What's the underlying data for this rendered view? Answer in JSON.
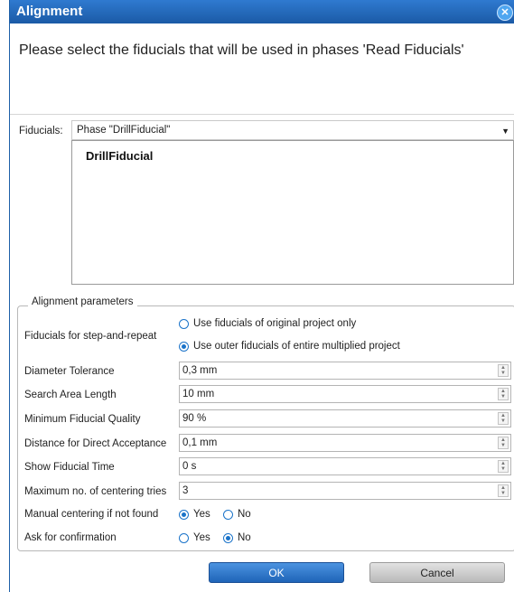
{
  "window": {
    "title": "Alignment",
    "close_symbol": "✕"
  },
  "instruction": "Please select the fiducials that will be used in phases 'Read Fiducials'",
  "fiducials": {
    "label": "Fiducials:",
    "selected_phase": "Phase \"DrillFiducial\"",
    "items": [
      "DrillFiducial"
    ]
  },
  "params": {
    "legend": "Alignment parameters",
    "step_repeat": {
      "label": "Fiducials for step-and-repeat",
      "options": [
        "Use fiducials of original project only",
        "Use outer fiducials of entire multiplied project"
      ],
      "selected": 1
    },
    "fields": [
      {
        "label": "Diameter Tolerance",
        "value": "0,3 mm"
      },
      {
        "label": "Search Area Length",
        "value": "10 mm"
      },
      {
        "label": "Minimum Fiducial Quality",
        "value": "90 %"
      },
      {
        "label": "Distance for Direct Acceptance",
        "value": "0,1 mm"
      },
      {
        "label": "Show Fiducial Time",
        "value": "0 s"
      },
      {
        "label": "Maximum no. of centering tries",
        "value": "3"
      }
    ],
    "manual_centering": {
      "label": "Manual centering if not found",
      "yes": "Yes",
      "no": "No",
      "selected": "yes"
    },
    "ask_confirmation": {
      "label": "Ask for confirmation",
      "yes": "Yes",
      "no": "No",
      "selected": "no"
    }
  },
  "buttons": {
    "ok": "OK",
    "cancel": "Cancel"
  },
  "colors": {
    "title_bar": "#1b5aa6",
    "accent": "#1a73c9",
    "ok_button": "#2f76cc",
    "cancel_button": "#c6c6c6"
  }
}
